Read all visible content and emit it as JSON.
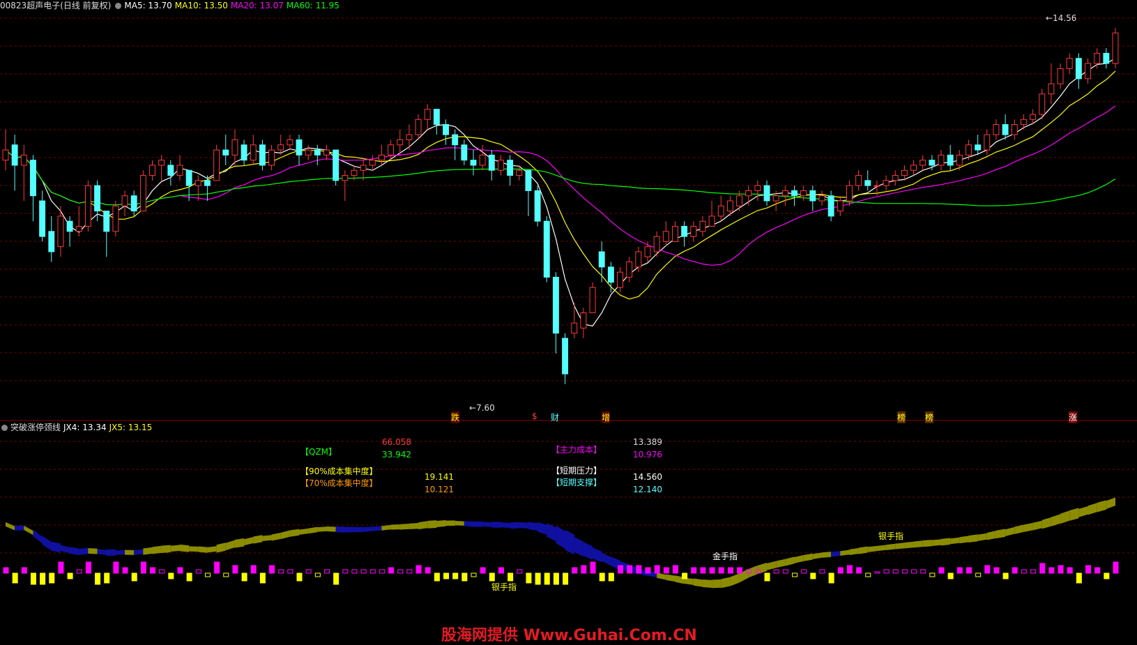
{
  "header": {
    "code": "00823",
    "title": "超声电子(日线 前复权)",
    "ma5_label": "MA5: 13.70",
    "ma10_label": "MA10: 13.50",
    "ma20_label": "MA20: 13.07",
    "ma60_label": "MA60: 11.95"
  },
  "sub_header": {
    "title": "突破涨停颈线",
    "jx4_label": "JX4: 13.34",
    "jx5_label": "JX5: 13.15"
  },
  "price_marks": {
    "high": "14.56",
    "low": "7.60"
  },
  "signals": [
    "跌",
    "$",
    "财",
    "增",
    "榜",
    "榜",
    "涨"
  ],
  "info": {
    "qzm_label": "【QZM】",
    "qzm_value": "33.942",
    "top_left_value": "66.058",
    "cost90_label": "【90%成本集中度】",
    "cost90_value": "19.141",
    "cost70_label": "【70%成本集中度】",
    "cost70_value": "10.121",
    "main_cost_label": "【主力成本】",
    "main_cost_value": "10.976",
    "top_right_value": "13.389",
    "pressure_label": "【短期压力】",
    "pressure_value": "14.560",
    "support_label": "【短期支撑】",
    "support_value": "12.140"
  },
  "annotations": {
    "silver1": "银手指",
    "gold": "金手指",
    "silver2": "银手指"
  },
  "watermark": "股海网提供 Www.Guhai.Com.CN",
  "colors": {
    "up": "#ff3a3a",
    "down": "#54ffff",
    "ma5": "#ffffff",
    "ma10": "#ffff00",
    "ma20": "#ff00ff",
    "ma60": "#00ff00",
    "band_up": "#8c8c00",
    "band_down": "#1010a0"
  },
  "chart_data": {
    "type": "candlestick",
    "ylim": [
      7.2,
      14.9
    ],
    "candles": [
      [
        12.0,
        12.6,
        12.2,
        11.8
      ],
      [
        12.3,
        12.5,
        11.9,
        11.4
      ],
      [
        11.9,
        12.3,
        12.1,
        11.2
      ],
      [
        12.0,
        12.1,
        11.3,
        10.8
      ],
      [
        11.2,
        11.4,
        10.5,
        10.4
      ],
      [
        10.6,
        10.9,
        10.2,
        10.0
      ],
      [
        10.3,
        11.1,
        10.9,
        10.1
      ],
      [
        10.8,
        10.9,
        10.6,
        10.3
      ],
      [
        10.6,
        11.1,
        10.7,
        10.5
      ],
      [
        10.7,
        11.6,
        11.5,
        10.6
      ],
      [
        11.5,
        11.6,
        11.0,
        10.8
      ],
      [
        11.0,
        11.0,
        10.6,
        10.1
      ],
      [
        10.6,
        11.2,
        11.1,
        10.5
      ],
      [
        11.1,
        11.4,
        11.3,
        10.9
      ],
      [
        11.3,
        11.4,
        11.0,
        10.9
      ],
      [
        11.0,
        11.8,
        11.7,
        11.0
      ],
      [
        11.7,
        12.0,
        11.9,
        11.6
      ],
      [
        11.9,
        12.1,
        12.0,
        11.6
      ],
      [
        11.9,
        12.0,
        11.7,
        11.5
      ],
      [
        11.7,
        12.1,
        11.9,
        11.6
      ],
      [
        11.8,
        11.8,
        11.5,
        11.2
      ],
      [
        11.5,
        11.7,
        11.6,
        11.2
      ],
      [
        11.6,
        11.7,
        11.5,
        11.2
      ],
      [
        11.6,
        12.3,
        12.2,
        11.6
      ],
      [
        12.2,
        12.5,
        12.1,
        11.9
      ],
      [
        12.1,
        12.6,
        12.4,
        11.9
      ],
      [
        12.3,
        12.4,
        12.0,
        11.9
      ],
      [
        12.0,
        12.5,
        12.3,
        11.9
      ],
      [
        12.3,
        12.4,
        11.9,
        11.8
      ],
      [
        11.9,
        12.3,
        12.2,
        11.8
      ],
      [
        12.2,
        12.5,
        12.3,
        12.1
      ],
      [
        12.3,
        12.5,
        12.4,
        12.2
      ],
      [
        12.4,
        12.5,
        12.1,
        11.9
      ],
      [
        12.1,
        12.3,
        12.2,
        12.0
      ],
      [
        12.2,
        12.3,
        12.1,
        11.9
      ],
      [
        12.1,
        12.3,
        12.2,
        12.0
      ],
      [
        12.2,
        12.2,
        11.6,
        11.5
      ],
      [
        11.6,
        11.8,
        11.7,
        11.2
      ],
      [
        11.7,
        11.9,
        11.8,
        11.6
      ],
      [
        11.8,
        12.0,
        11.9,
        11.6
      ],
      [
        11.9,
        12.1,
        12.0,
        11.8
      ],
      [
        12.0,
        12.3,
        12.1,
        11.9
      ],
      [
        12.1,
        12.4,
        12.3,
        12.0
      ],
      [
        12.3,
        12.6,
        12.4,
        12.1
      ],
      [
        12.4,
        12.7,
        12.5,
        12.2
      ],
      [
        12.5,
        12.9,
        12.8,
        12.4
      ],
      [
        12.8,
        13.1,
        13.0,
        12.6
      ],
      [
        13.0,
        13.0,
        12.7,
        12.5
      ],
      [
        12.7,
        12.8,
        12.5,
        12.3
      ],
      [
        12.5,
        12.6,
        12.3,
        12.0
      ],
      [
        12.3,
        12.4,
        12.0,
        11.9
      ],
      [
        12.0,
        12.2,
        11.9,
        11.7
      ],
      [
        11.9,
        12.3,
        12.1,
        11.8
      ],
      [
        12.1,
        12.2,
        11.8,
        11.6
      ],
      [
        11.8,
        12.1,
        12.0,
        11.7
      ],
      [
        12.0,
        12.1,
        11.7,
        11.5
      ],
      [
        11.7,
        11.9,
        11.8,
        11.6
      ],
      [
        11.8,
        11.8,
        11.4,
        10.9
      ],
      [
        11.4,
        11.5,
        10.8,
        10.7
      ],
      [
        10.8,
        10.9,
        9.7,
        9.6
      ],
      [
        9.7,
        9.8,
        8.6,
        8.2
      ],
      [
        8.5,
        8.6,
        7.8,
        7.6
      ],
      [
        8.6,
        9.2,
        8.8,
        8.5
      ],
      [
        8.7,
        9.1,
        9.0,
        8.5
      ],
      [
        9.0,
        9.6,
        9.5,
        9.2
      ],
      [
        10.2,
        10.4,
        9.9,
        9.6
      ],
      [
        9.9,
        10.0,
        9.6,
        9.4
      ],
      [
        9.5,
        9.9,
        9.8,
        9.4
      ],
      [
        9.7,
        10.1,
        10.0,
        9.6
      ],
      [
        9.9,
        10.3,
        10.2,
        9.8
      ],
      [
        10.1,
        10.4,
        10.3,
        10.0
      ],
      [
        10.2,
        10.6,
        10.5,
        10.1
      ],
      [
        10.4,
        10.8,
        10.6,
        10.3
      ],
      [
        10.4,
        10.8,
        10.7,
        10.4
      ],
      [
        10.7,
        10.8,
        10.5,
        10.3
      ],
      [
        10.5,
        10.8,
        10.7,
        10.4
      ],
      [
        10.6,
        10.9,
        10.8,
        10.5
      ],
      [
        10.7,
        11.2,
        10.9,
        10.7
      ],
      [
        10.9,
        11.3,
        11.1,
        10.8
      ],
      [
        11.0,
        11.3,
        11.2,
        10.9
      ],
      [
        11.1,
        11.4,
        11.3,
        11.0
      ],
      [
        11.3,
        11.5,
        11.4,
        11.1
      ],
      [
        11.4,
        11.6,
        11.5,
        11.2
      ],
      [
        11.5,
        11.6,
        11.2,
        11.1
      ],
      [
        11.2,
        11.4,
        11.3,
        11.0
      ],
      [
        11.3,
        11.5,
        11.4,
        11.1
      ],
      [
        11.4,
        11.5,
        11.3,
        11.1
      ],
      [
        11.3,
        11.5,
        11.4,
        11.2
      ],
      [
        11.4,
        11.5,
        11.2,
        11.0
      ],
      [
        11.2,
        11.4,
        11.3,
        11.1
      ],
      [
        11.3,
        11.4,
        10.9,
        10.8
      ],
      [
        11.0,
        11.3,
        11.2,
        10.9
      ],
      [
        11.2,
        11.6,
        11.5,
        11.1
      ],
      [
        11.5,
        11.8,
        11.7,
        11.4
      ],
      [
        11.6,
        11.8,
        11.5,
        11.4
      ],
      [
        11.5,
        11.6,
        11.5,
        11.3
      ],
      [
        11.5,
        11.7,
        11.6,
        11.4
      ],
      [
        11.6,
        11.8,
        11.7,
        11.5
      ],
      [
        11.7,
        11.9,
        11.8,
        11.6
      ],
      [
        11.8,
        12.0,
        11.9,
        11.7
      ],
      [
        11.9,
        12.1,
        12.0,
        11.8
      ],
      [
        12.0,
        12.1,
        11.9,
        11.8
      ],
      [
        11.9,
        12.2,
        12.1,
        11.8
      ],
      [
        12.1,
        12.3,
        11.9,
        11.8
      ],
      [
        11.9,
        12.2,
        12.1,
        11.8
      ],
      [
        12.1,
        12.4,
        12.3,
        12.0
      ],
      [
        12.3,
        12.5,
        12.2,
        12.1
      ],
      [
        12.2,
        12.6,
        12.5,
        12.1
      ],
      [
        12.5,
        12.8,
        12.7,
        12.4
      ],
      [
        12.7,
        12.9,
        12.5,
        12.4
      ],
      [
        12.5,
        12.8,
        12.7,
        12.4
      ],
      [
        12.7,
        12.9,
        12.8,
        12.6
      ],
      [
        12.8,
        13.0,
        12.9,
        12.7
      ],
      [
        12.9,
        13.4,
        13.3,
        12.8
      ],
      [
        13.3,
        13.9,
        13.5,
        13.1
      ],
      [
        13.5,
        13.9,
        13.8,
        13.4
      ],
      [
        13.8,
        14.1,
        14.0,
        13.7
      ],
      [
        14.0,
        14.1,
        13.6,
        13.4
      ],
      [
        13.6,
        14.0,
        13.9,
        13.5
      ],
      [
        13.9,
        14.2,
        14.1,
        13.8
      ],
      [
        14.1,
        14.2,
        13.9,
        13.8
      ],
      [
        13.9,
        14.6,
        14.5,
        13.8
      ]
    ]
  }
}
